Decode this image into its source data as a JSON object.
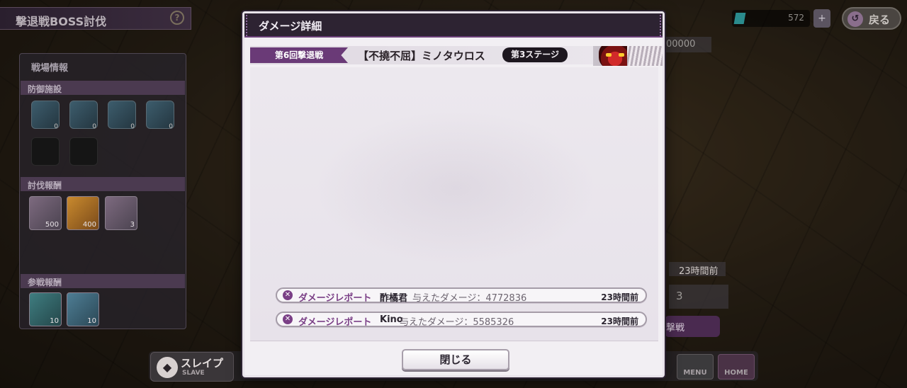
{
  "screen": {
    "title": "撃退戦BOSS討伐",
    "help_icon": "?",
    "currency_value": "572",
    "currency_add_icon": "+",
    "back_label": "戻る",
    "back_icon": "↺"
  },
  "left_panel": {
    "title": "戦場情報",
    "defense_header": "防御施設",
    "defense_slots": [
      {
        "icon": "hammer-icon",
        "count": "0"
      },
      {
        "icon": "shield-icon",
        "count": "0"
      },
      {
        "icon": "horn-icon",
        "count": "0"
      },
      {
        "icon": "dice-icon",
        "count": "0"
      },
      {
        "icon": "lock-icon",
        "count": ""
      },
      {
        "icon": "lock-icon",
        "count": ""
      }
    ],
    "subjugation_header": "討伐報酬",
    "subjugation_rewards": [
      {
        "icon": "crystal-icon",
        "count": "500"
      },
      {
        "icon": "orb-icon",
        "count": "400"
      },
      {
        "icon": "ticket-icon",
        "count": "3"
      }
    ],
    "participation_header": "参戦報酬",
    "participation_rewards": [
      {
        "icon": "rune-icon",
        "count": "10"
      },
      {
        "icon": "gem-icon",
        "count": "10"
      }
    ]
  },
  "right_fragments": {
    "score_fragment": "00000",
    "time_fragment": "23時間前",
    "count_fragment": "3",
    "button_fragment": "撃戦"
  },
  "bottom_nav": {
    "slave_label": "スレイプ",
    "slave_sub": "SLAVE",
    "menu_label": "MENU",
    "home_label": "HOME"
  },
  "modal": {
    "title": "ダメージ詳細",
    "round_label": "第6回撃退戦",
    "boss_name": "【不撓不屈】ミノタウロス",
    "stage_label": "第3ステージ",
    "reports": [
      {
        "label": "ダメージレポート",
        "player": "酢橘君",
        "damage": "与えたダメージ：4772836",
        "time": "23時間前"
      },
      {
        "label": "ダメージレポート",
        "player": "Kino",
        "damage": "与えたダメージ：5585326",
        "time": "23時間前"
      }
    ],
    "close_label": "閉じる"
  },
  "colors": {
    "accent_purple": "#7a3f86",
    "header_dark": "#2d2332",
    "modal_bg": "#f2eff3"
  }
}
